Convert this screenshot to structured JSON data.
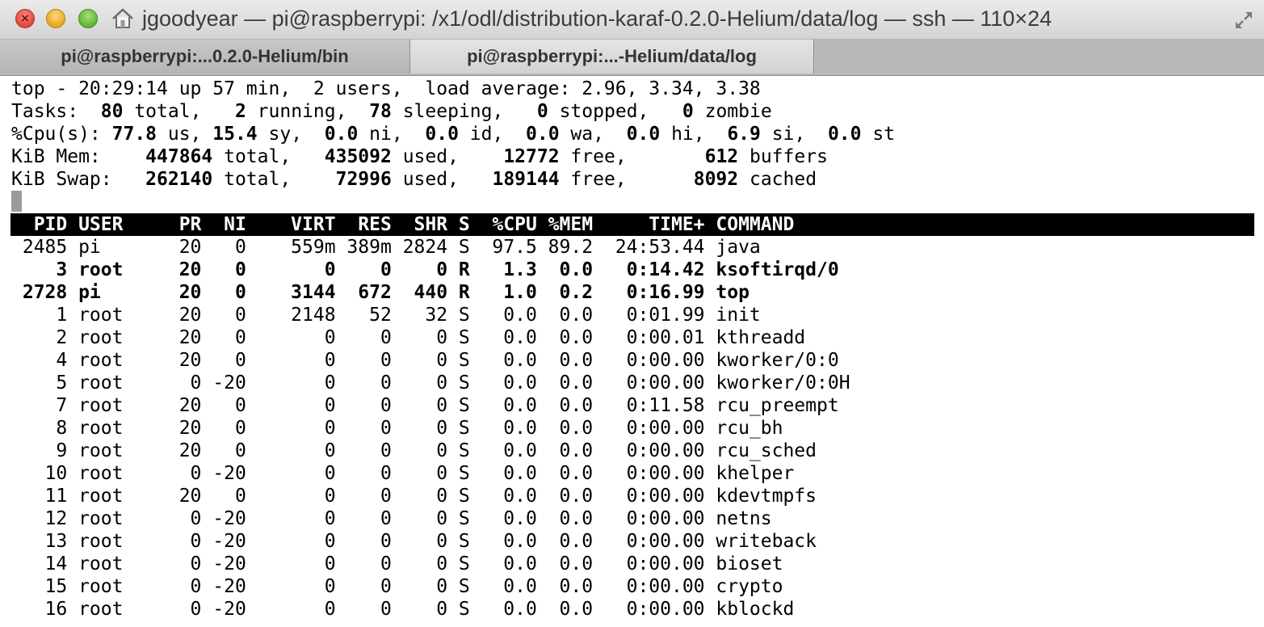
{
  "window": {
    "title": "jgoodyear — pi@raspberrypi: /x1/odl/distribution-karaf-0.2.0-Helium/data/log — ssh — 110×24",
    "icons": [
      "close-icon",
      "minimize-icon",
      "zoom-icon",
      "home-icon",
      "fullscreen-icon"
    ]
  },
  "tabs": [
    {
      "label": "pi@raspberrypi:...0.2.0-Helium/bin",
      "active": false
    },
    {
      "label": "pi@raspberrypi:...-Helium/data/log",
      "active": true
    }
  ],
  "summary": {
    "line1": "top - 20:29:14 up 57 min,  2 users,  load average: 2.96, 3.34, 3.38",
    "tasks": {
      "total": "80",
      "running": "2",
      "sleeping": "78",
      "stopped": "0",
      "zombie": "0"
    },
    "cpu": {
      "us": "77.8",
      "sy": "15.4",
      "ni": "0.0",
      "id": "0.0",
      "wa": "0.0",
      "hi": "0.0",
      "si": "6.9",
      "st": "0.0"
    },
    "mem": {
      "total": "447864",
      "used": "435092",
      "free": "12772",
      "buffers": "612"
    },
    "swap": {
      "total": "262140",
      "used": "72996",
      "free": "189144",
      "cached": "8092"
    }
  },
  "columns": [
    "PID",
    "USER",
    "PR",
    "NI",
    "VIRT",
    "RES",
    "SHR",
    "S",
    "%CPU",
    "%MEM",
    "TIME+",
    "COMMAND"
  ],
  "processes": [
    {
      "pid": "2485",
      "user": "pi",
      "pr": "20",
      "ni": "0",
      "virt": "559m",
      "res": "389m",
      "shr": "2824",
      "s": "S",
      "cpu": "97.5",
      "mem": "89.2",
      "time": "24:53.44",
      "command": "java",
      "bold": false
    },
    {
      "pid": "3",
      "user": "root",
      "pr": "20",
      "ni": "0",
      "virt": "0",
      "res": "0",
      "shr": "0",
      "s": "R",
      "cpu": "1.3",
      "mem": "0.0",
      "time": "0:14.42",
      "command": "ksoftirqd/0",
      "bold": true
    },
    {
      "pid": "2728",
      "user": "pi",
      "pr": "20",
      "ni": "0",
      "virt": "3144",
      "res": "672",
      "shr": "440",
      "s": "R",
      "cpu": "1.0",
      "mem": "0.2",
      "time": "0:16.99",
      "command": "top",
      "bold": true
    },
    {
      "pid": "1",
      "user": "root",
      "pr": "20",
      "ni": "0",
      "virt": "2148",
      "res": "52",
      "shr": "32",
      "s": "S",
      "cpu": "0.0",
      "mem": "0.0",
      "time": "0:01.99",
      "command": "init",
      "bold": false
    },
    {
      "pid": "2",
      "user": "root",
      "pr": "20",
      "ni": "0",
      "virt": "0",
      "res": "0",
      "shr": "0",
      "s": "S",
      "cpu": "0.0",
      "mem": "0.0",
      "time": "0:00.01",
      "command": "kthreadd",
      "bold": false
    },
    {
      "pid": "4",
      "user": "root",
      "pr": "20",
      "ni": "0",
      "virt": "0",
      "res": "0",
      "shr": "0",
      "s": "S",
      "cpu": "0.0",
      "mem": "0.0",
      "time": "0:00.00",
      "command": "kworker/0:0",
      "bold": false
    },
    {
      "pid": "5",
      "user": "root",
      "pr": "0",
      "ni": "-20",
      "virt": "0",
      "res": "0",
      "shr": "0",
      "s": "S",
      "cpu": "0.0",
      "mem": "0.0",
      "time": "0:00.00",
      "command": "kworker/0:0H",
      "bold": false
    },
    {
      "pid": "7",
      "user": "root",
      "pr": "20",
      "ni": "0",
      "virt": "0",
      "res": "0",
      "shr": "0",
      "s": "S",
      "cpu": "0.0",
      "mem": "0.0",
      "time": "0:11.58",
      "command": "rcu_preempt",
      "bold": false
    },
    {
      "pid": "8",
      "user": "root",
      "pr": "20",
      "ni": "0",
      "virt": "0",
      "res": "0",
      "shr": "0",
      "s": "S",
      "cpu": "0.0",
      "mem": "0.0",
      "time": "0:00.00",
      "command": "rcu_bh",
      "bold": false
    },
    {
      "pid": "9",
      "user": "root",
      "pr": "20",
      "ni": "0",
      "virt": "0",
      "res": "0",
      "shr": "0",
      "s": "S",
      "cpu": "0.0",
      "mem": "0.0",
      "time": "0:00.00",
      "command": "rcu_sched",
      "bold": false
    },
    {
      "pid": "10",
      "user": "root",
      "pr": "0",
      "ni": "-20",
      "virt": "0",
      "res": "0",
      "shr": "0",
      "s": "S",
      "cpu": "0.0",
      "mem": "0.0",
      "time": "0:00.00",
      "command": "khelper",
      "bold": false
    },
    {
      "pid": "11",
      "user": "root",
      "pr": "20",
      "ni": "0",
      "virt": "0",
      "res": "0",
      "shr": "0",
      "s": "S",
      "cpu": "0.0",
      "mem": "0.0",
      "time": "0:00.00",
      "command": "kdevtmpfs",
      "bold": false
    },
    {
      "pid": "12",
      "user": "root",
      "pr": "0",
      "ni": "-20",
      "virt": "0",
      "res": "0",
      "shr": "0",
      "s": "S",
      "cpu": "0.0",
      "mem": "0.0",
      "time": "0:00.00",
      "command": "netns",
      "bold": false
    },
    {
      "pid": "13",
      "user": "root",
      "pr": "0",
      "ni": "-20",
      "virt": "0",
      "res": "0",
      "shr": "0",
      "s": "S",
      "cpu": "0.0",
      "mem": "0.0",
      "time": "0:00.00",
      "command": "writeback",
      "bold": false
    },
    {
      "pid": "14",
      "user": "root",
      "pr": "0",
      "ni": "-20",
      "virt": "0",
      "res": "0",
      "shr": "0",
      "s": "S",
      "cpu": "0.0",
      "mem": "0.0",
      "time": "0:00.00",
      "command": "bioset",
      "bold": false
    },
    {
      "pid": "15",
      "user": "root",
      "pr": "0",
      "ni": "-20",
      "virt": "0",
      "res": "0",
      "shr": "0",
      "s": "S",
      "cpu": "0.0",
      "mem": "0.0",
      "time": "0:00.00",
      "command": "crypto",
      "bold": false
    },
    {
      "pid": "16",
      "user": "root",
      "pr": "0",
      "ni": "-20",
      "virt": "0",
      "res": "0",
      "shr": "0",
      "s": "S",
      "cpu": "0.0",
      "mem": "0.0",
      "time": "0:00.00",
      "command": "kblockd",
      "bold": false
    }
  ]
}
